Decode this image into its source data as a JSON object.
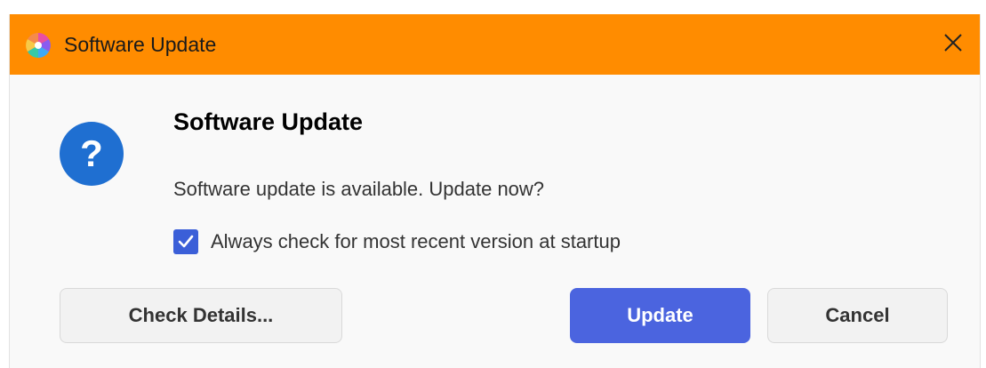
{
  "window": {
    "title": "Software Update",
    "titlebar_color": "#ff8c00",
    "app_icon": "software-update-app-icon",
    "close_icon": "close-icon"
  },
  "dialog": {
    "icon": "question-icon",
    "heading": "Software Update",
    "message": "Software update is available. Update now?",
    "checkbox": {
      "label": "Always check for most recent version at startup",
      "checked": true,
      "color": "#3b5fd8"
    }
  },
  "buttons": {
    "details_label": "Check Details...",
    "update_label": "Update",
    "cancel_label": "Cancel",
    "primary_color": "#4b64df"
  }
}
